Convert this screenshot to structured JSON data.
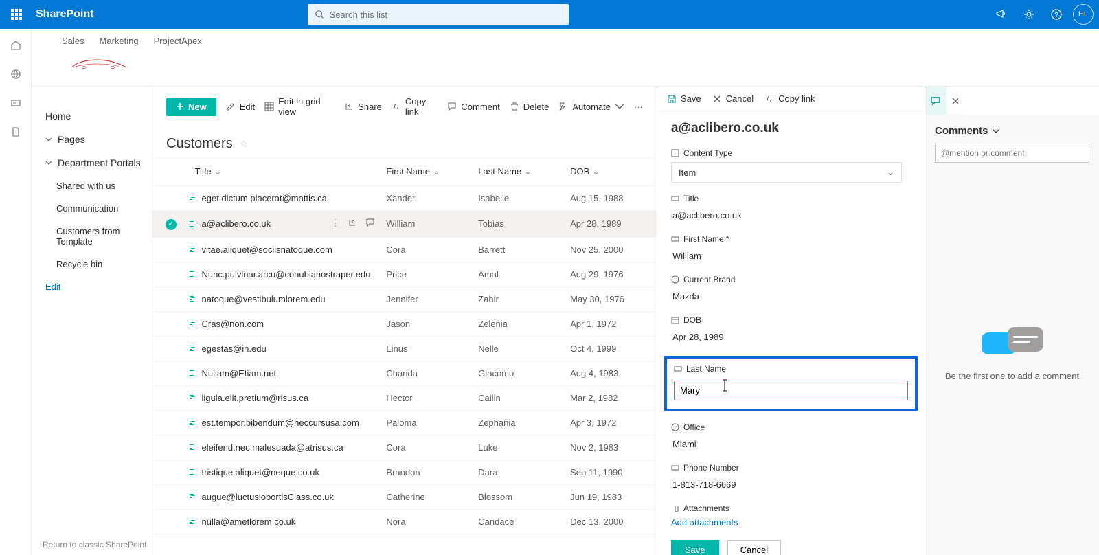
{
  "brand": "SharePoint",
  "search_placeholder": "Search this list",
  "avatar_initials": "HL",
  "site_tabs": [
    "Sales",
    "Marketing",
    "ProjectApex"
  ],
  "leftnav": {
    "home": "Home",
    "pages": "Pages",
    "dept": "Department Portals",
    "shared": "Shared with us",
    "comm": "Communication",
    "cft": "Customers from Template",
    "recycle": "Recycle bin",
    "edit": "Edit",
    "return": "Return to classic SharePoint"
  },
  "cmd": {
    "new": "New",
    "edit": "Edit",
    "grid": "Edit in grid view",
    "share": "Share",
    "copylink": "Copy link",
    "comment": "Comment",
    "delete": "Delete",
    "automate": "Automate"
  },
  "list_title": "Customers",
  "columns": {
    "title": "Title",
    "first": "First Name",
    "last": "Last Name",
    "dob": "DOB"
  },
  "rows": [
    {
      "title": "eget.dictum.placerat@mattis.ca",
      "first": "Xander",
      "last": "Isabelle",
      "dob": "Aug 15, 1988"
    },
    {
      "title": "a@aclibero.co.uk",
      "first": "William",
      "last": "Tobias",
      "dob": "Apr 28, 1989",
      "selected": true
    },
    {
      "title": "vitae.aliquet@sociisnatoque.com",
      "first": "Cora",
      "last": "Barrett",
      "dob": "Nov 25, 2000"
    },
    {
      "title": "Nunc.pulvinar.arcu@conubianostraper.edu",
      "first": "Price",
      "last": "Amal",
      "dob": "Aug 29, 1976"
    },
    {
      "title": "natoque@vestibulumlorem.edu",
      "first": "Jennifer",
      "last": "Zahir",
      "dob": "May 30, 1976"
    },
    {
      "title": "Cras@non.com",
      "first": "Jason",
      "last": "Zelenia",
      "dob": "Apr 1, 1972"
    },
    {
      "title": "egestas@in.edu",
      "first": "Linus",
      "last": "Nelle",
      "dob": "Oct 4, 1999"
    },
    {
      "title": "Nullam@Etiam.net",
      "first": "Chanda",
      "last": "Giacomo",
      "dob": "Aug 4, 1983"
    },
    {
      "title": "ligula.elit.pretium@risus.ca",
      "first": "Hector",
      "last": "Cailin",
      "dob": "Mar 2, 1982"
    },
    {
      "title": "est.tempor.bibendum@neccursusa.com",
      "first": "Paloma",
      "last": "Zephania",
      "dob": "Apr 3, 1972"
    },
    {
      "title": "eleifend.nec.malesuada@atrisus.ca",
      "first": "Cora",
      "last": "Luke",
      "dob": "Nov 2, 1983"
    },
    {
      "title": "tristique.aliquet@neque.co.uk",
      "first": "Brandon",
      "last": "Dara",
      "dob": "Sep 11, 1990"
    },
    {
      "title": "augue@luctuslobortisClass.co.uk",
      "first": "Catherine",
      "last": "Blossom",
      "dob": "Jun 19, 1983"
    },
    {
      "title": "nulla@ametlorem.co.uk",
      "first": "Nora",
      "last": "Candace",
      "dob": "Dec 13, 2000"
    }
  ],
  "panel": {
    "toolbar": {
      "save": "Save",
      "cancel": "Cancel",
      "copylink": "Copy link"
    },
    "title": "a@aclibero.co.uk",
    "labels": {
      "ctype": "Content Type",
      "title": "Title",
      "first": "First Name *",
      "brand": "Current Brand",
      "dob": "DOB",
      "last": "Last Name",
      "office": "Office",
      "phone": "Phone Number",
      "attach": "Attachments",
      "addattach": "Add attachments"
    },
    "values": {
      "ctype": "Item",
      "title": "a@aclibero.co.uk",
      "first": "William",
      "brand": "Mazda",
      "dob": "Apr 28, 1989",
      "last": "Mary",
      "office": "Miami",
      "phone": "1-813-718-6669"
    },
    "buttons": {
      "save": "Save",
      "cancel": "Cancel"
    }
  },
  "comments": {
    "heading": "Comments",
    "placeholder": "@mention or comment",
    "empty": "Be the first one to add a comment"
  }
}
